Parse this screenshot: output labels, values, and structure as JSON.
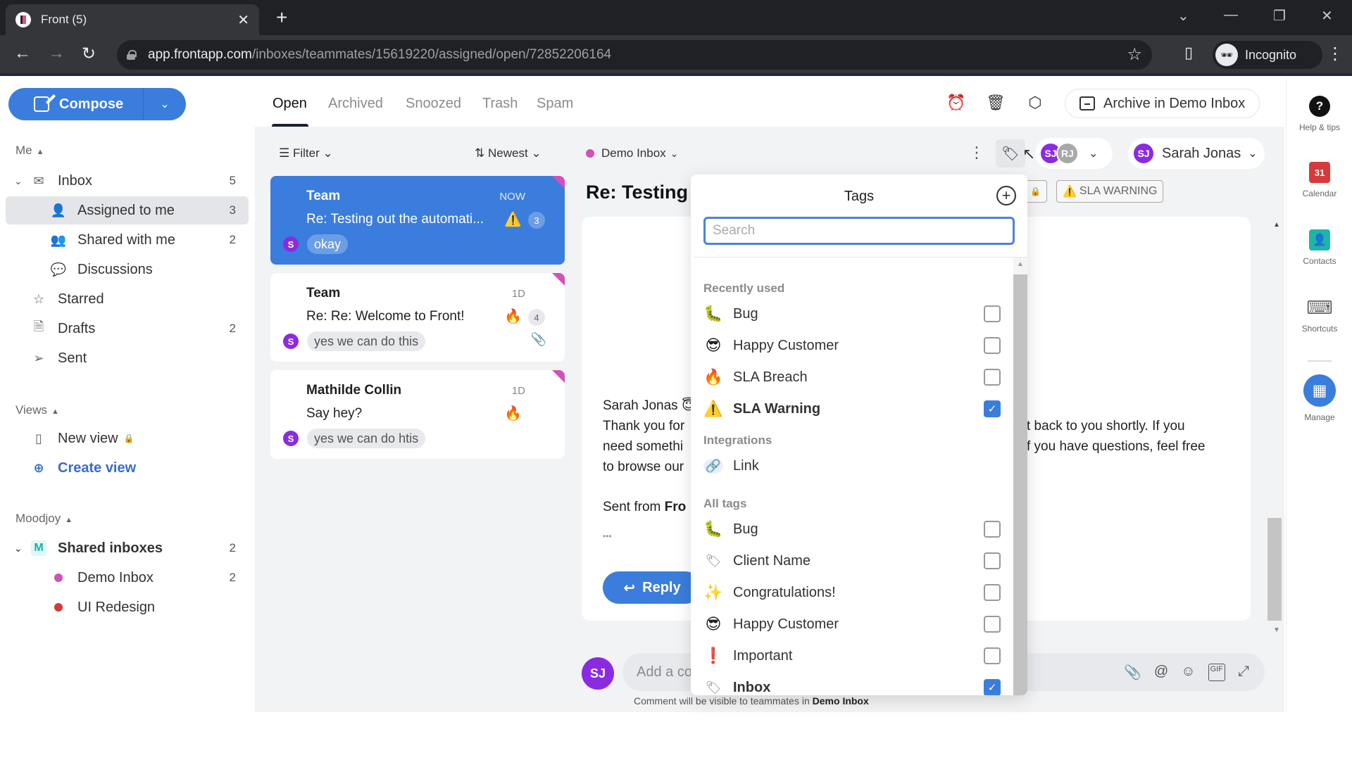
{
  "browser": {
    "tab_title": "Front (5)",
    "url_host": "app.frontapp.com",
    "url_path": "/inboxes/teammates/15619220/assigned/open/72852206164",
    "profile_label": "Incognito"
  },
  "sidebar": {
    "compose_label": "Compose",
    "me_section": "Me",
    "items": [
      {
        "label": "Inbox",
        "count": "5"
      },
      {
        "label": "Assigned to me",
        "count": "3"
      },
      {
        "label": "Shared with me",
        "count": "2"
      },
      {
        "label": "Discussions",
        "count": ""
      },
      {
        "label": "Starred",
        "count": ""
      },
      {
        "label": "Drafts",
        "count": "2"
      },
      {
        "label": "Sent",
        "count": ""
      }
    ],
    "views_section": "Views",
    "views": [
      {
        "label": "New view"
      },
      {
        "label": "Create view"
      }
    ],
    "team_section": "Moodjoy",
    "shared_inboxes": {
      "label": "Shared inboxes",
      "count": "2",
      "badge": "M"
    },
    "inboxes": [
      {
        "label": "Demo Inbox",
        "count": "2",
        "color": "#d44fb7"
      },
      {
        "label": "UI Redesign",
        "count": "",
        "color": "#d63939"
      }
    ]
  },
  "list": {
    "tabs": [
      "Open",
      "Archived",
      "Snoozed",
      "Trash",
      "Spam"
    ],
    "active_tab": "Open",
    "filter_label": "Filter",
    "sort_label": "Newest",
    "conversations": [
      {
        "from": "Team",
        "time": "NOW",
        "subject": "Re: Testing out the automati...",
        "emoji": "⚠️",
        "count": "3",
        "avatar": "S",
        "preview": "okay",
        "attachment": false
      },
      {
        "from": "Team",
        "time": "1D",
        "subject": "Re: Re: Welcome to Front!",
        "emoji": "🔥",
        "count": "4",
        "avatar": "S",
        "preview": "yes we can do this",
        "attachment": true
      },
      {
        "from": "Mathilde Collin",
        "time": "1D",
        "subject": "Say hey?",
        "emoji": "🔥",
        "count": "",
        "avatar": "S",
        "preview": "yes we can do htis",
        "attachment": false
      }
    ]
  },
  "conversation": {
    "archive_label": "Archive in Demo Inbox",
    "inbox_label": "Demo Inbox",
    "inbox_color": "#d44fb7",
    "assignees": [
      {
        "initials": "SJ",
        "color": "#8a2be2"
      },
      {
        "initials": "RJ",
        "color": "#a8a8a8"
      }
    ],
    "owner": {
      "initials": "SJ",
      "name": "Sarah Jonas"
    },
    "title": "Re: Testing",
    "tag_chips": [
      "SLA WARNING"
    ],
    "message": {
      "sender": "Sarah Jonas",
      "line1_left": "Thank you for",
      "line1_right": "t back to you shortly. If you",
      "line2_left": "need somethi",
      "line2_right": "f you have questions, feel free",
      "line3_left": "to browse our",
      "signature_prefix": "Sent from ",
      "signature_bold": "Fro",
      "ellipsis": "•••"
    },
    "reply_label": "Reply",
    "comment_placeholder": "Add a comment",
    "comment_note_prefix": "Comment will be visible to teammates in ",
    "comment_note_inbox": "Demo Inbox"
  },
  "rail": [
    {
      "label": "Help & tips",
      "icon": "help-icon"
    },
    {
      "label": "Calendar",
      "icon": "calendar-icon",
      "text": "31"
    },
    {
      "label": "Contacts",
      "icon": "contacts-icon"
    },
    {
      "label": "Shortcuts",
      "icon": "keyboard-icon"
    },
    {
      "label": "Manage",
      "icon": "grid-icon"
    }
  ],
  "tags": {
    "title": "Tags",
    "search_placeholder": "Search",
    "recent_header": "Recently used",
    "recent": [
      {
        "icon": "🐛",
        "label": "Bug",
        "checked": false
      },
      {
        "icon": "😎",
        "label": "Happy Customer",
        "checked": false
      },
      {
        "icon": "🔥",
        "label": "SLA Breach",
        "checked": false
      },
      {
        "icon": "⚠️",
        "label": "SLA Warning",
        "checked": true
      }
    ],
    "integrations_header": "Integrations",
    "integrations": [
      {
        "icon": "🔗",
        "label": "Link"
      }
    ],
    "all_header": "All tags",
    "all": [
      {
        "icon": "🐛",
        "label": "Bug",
        "checked": false
      },
      {
        "icon": "🏷",
        "label": "Client Name",
        "checked": false
      },
      {
        "icon": "✨",
        "label": "Congratulations!",
        "checked": false
      },
      {
        "icon": "😎",
        "label": "Happy Customer",
        "checked": false
      },
      {
        "icon": "❗",
        "label": "Important",
        "checked": false
      },
      {
        "icon": "🏷",
        "label": "Inbox",
        "checked": true
      }
    ]
  }
}
